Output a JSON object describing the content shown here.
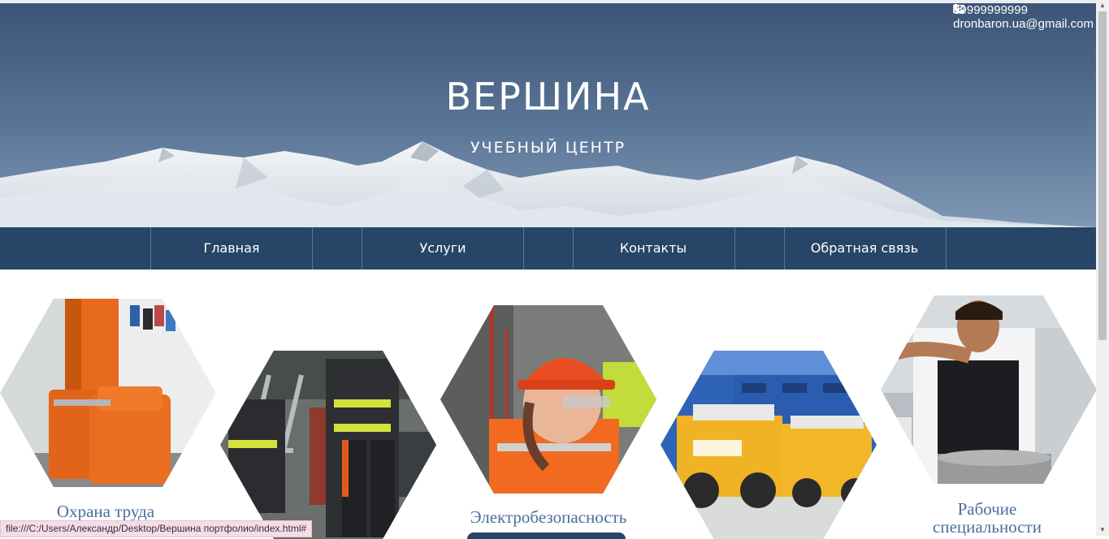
{
  "header": {
    "title": "ВЕРШИНА",
    "subtitle": "УЧЕБНЫЙ ЦЕНТР",
    "phone": "89999999999",
    "email": "dronbaron.ua@gmail.com",
    "phone_icon": "phone-icon",
    "email_icon": "envelope-icon"
  },
  "nav": {
    "items": [
      {
        "label": "Главная"
      },
      {
        "label": "Услуги"
      },
      {
        "label": "Контакты"
      },
      {
        "label": "Обратная связь"
      }
    ]
  },
  "cards": [
    {
      "caption": "Охрана труда",
      "image": "orange-armchair-office"
    },
    {
      "caption": "",
      "image": "firefighter-gear"
    },
    {
      "caption": "Электробезопасность",
      "image": "worker-orange-helmet"
    },
    {
      "caption": "",
      "image": "yellow-mining-trucks"
    },
    {
      "caption_line1": "Рабочие",
      "caption_line2": "специальности",
      "image": "chef-cooking"
    }
  ],
  "statusbar": {
    "url": "file:///C:/Users/Александр/Desktop/Вершина портфолио/index.html#"
  },
  "colors": {
    "nav_bg": "#274566",
    "caption": "#4a6e9b",
    "hero_sky": "#5b7597"
  }
}
